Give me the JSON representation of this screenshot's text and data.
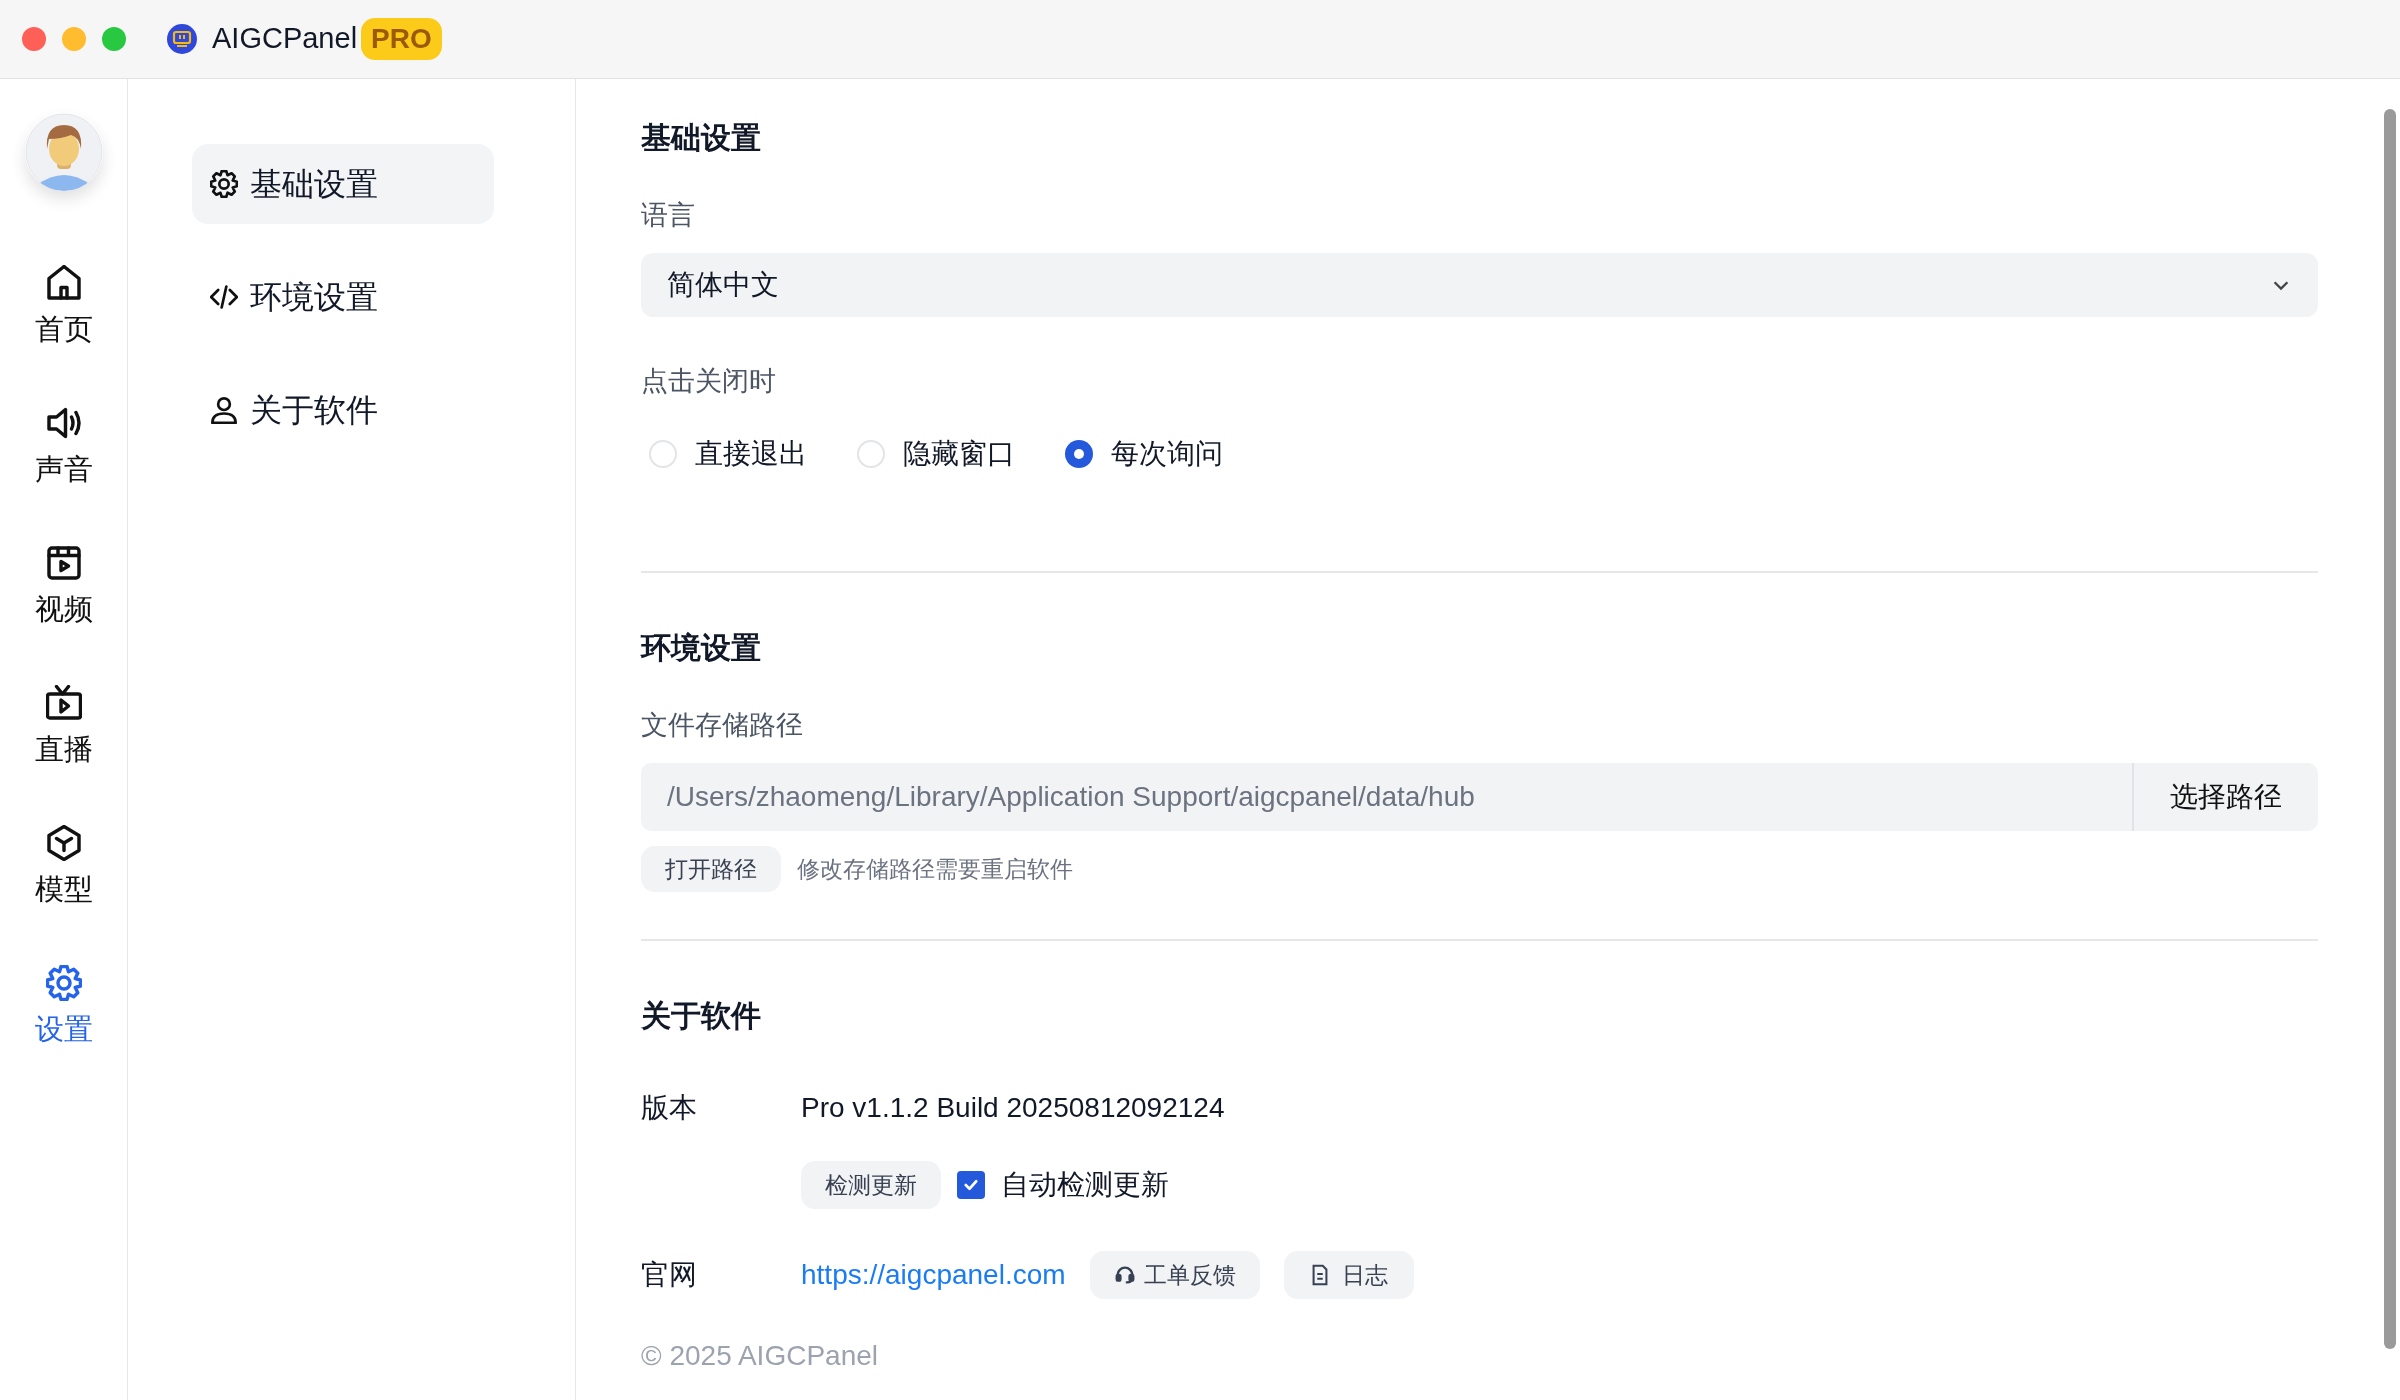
{
  "window": {
    "title": "AIGCPanel",
    "badge": "PRO"
  },
  "rail": [
    {
      "label": "首页",
      "kind": "home",
      "selected": false
    },
    {
      "label": "声音",
      "kind": "speaker",
      "selected": false
    },
    {
      "label": "视频",
      "kind": "video",
      "selected": false
    },
    {
      "label": "直播",
      "kind": "tv",
      "selected": false
    },
    {
      "label": "模型",
      "kind": "cube",
      "selected": false
    },
    {
      "label": "设置",
      "kind": "gear",
      "selected": true
    }
  ],
  "settings_nav": [
    {
      "label": "基础设置",
      "kind": "gear",
      "selected": true
    },
    {
      "label": "环境设置",
      "kind": "code",
      "selected": false
    },
    {
      "label": "关于软件",
      "kind": "user",
      "selected": false
    }
  ],
  "basic": {
    "title": "基础设置",
    "language": {
      "label": "语言",
      "value": "简体中文"
    },
    "close_action": {
      "label": "点击关闭时",
      "options": [
        {
          "label": "直接退出",
          "selected": false
        },
        {
          "label": "隐藏窗口",
          "selected": false
        },
        {
          "label": "每次询问",
          "selected": true
        }
      ]
    }
  },
  "environment": {
    "title": "环境设置",
    "storage": {
      "label": "文件存储路径",
      "value": "/Users/zhaomeng/Library/Application Support/aigcpanel/data/hub",
      "button": "选择路径"
    },
    "open_button": "打开路径",
    "hint": "修改存储路径需要重启软件"
  },
  "about": {
    "title": "关于软件",
    "version_label": "版本",
    "version": "Pro v1.1.2 Build 20250812092124",
    "check_button": "检测更新",
    "auto_check": {
      "label": "自动检测更新",
      "checked": true
    },
    "website_label": "官网",
    "website": "https://aigcpanel.com",
    "feedback_button": "工单反馈",
    "log_button": "日志"
  },
  "footer": "© 2025 AIGCPanel"
}
